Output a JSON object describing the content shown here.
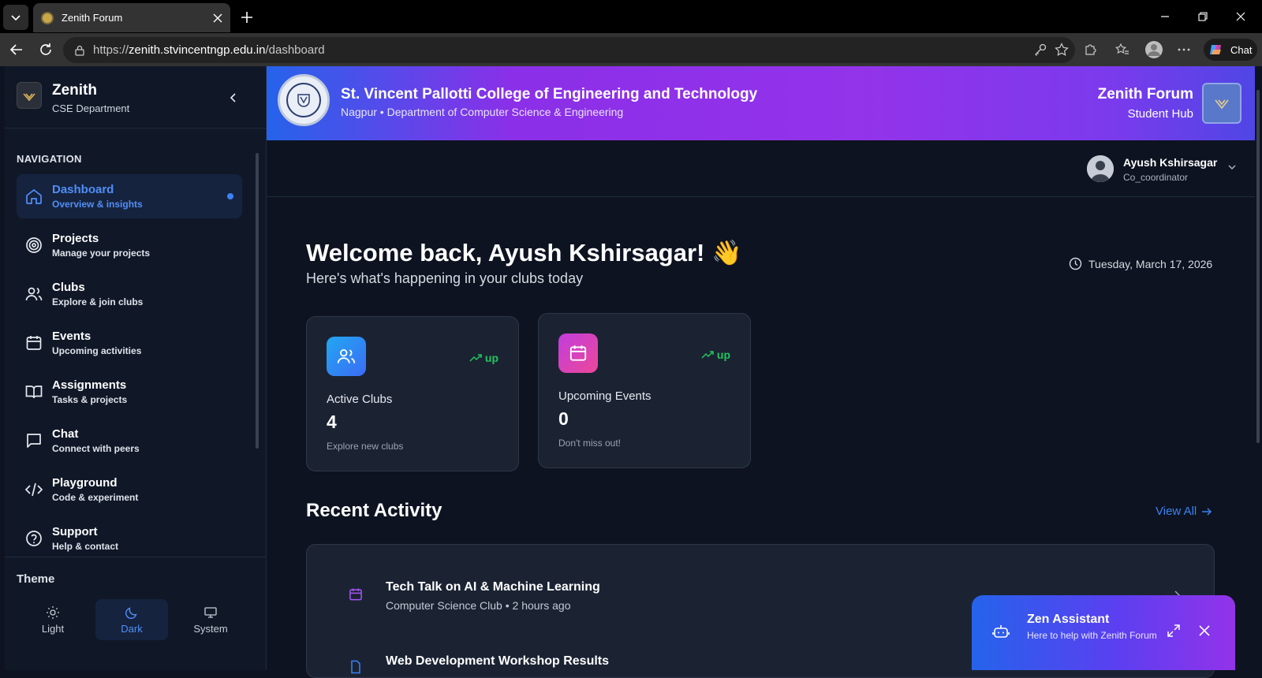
{
  "browser": {
    "tab_title": "Zenith Forum",
    "url_prefix": "https://",
    "url_host": "zenith.stvincentngp.edu.in",
    "url_path": "/dashboard",
    "chat_label": "Chat"
  },
  "sidebar": {
    "title": "Zenith",
    "subtitle": "CSE Department",
    "nav_heading": "NAVIGATION",
    "items": [
      {
        "label": "Dashboard",
        "desc": "Overview & insights",
        "icon": "home-icon",
        "active": true
      },
      {
        "label": "Projects",
        "desc": "Manage your projects",
        "icon": "target-icon"
      },
      {
        "label": "Clubs",
        "desc": "Explore & join clubs",
        "icon": "users-icon"
      },
      {
        "label": "Events",
        "desc": "Upcoming activities",
        "icon": "calendar-icon"
      },
      {
        "label": "Assignments",
        "desc": "Tasks & projects",
        "icon": "book-icon"
      },
      {
        "label": "Chat",
        "desc": "Connect with peers",
        "icon": "chat-icon"
      },
      {
        "label": "Playground",
        "desc": "Code & experiment",
        "icon": "code-icon"
      },
      {
        "label": "Support",
        "desc": "Help & contact",
        "icon": "help-icon"
      }
    ],
    "theme_heading": "Theme",
    "themes": [
      {
        "label": "Light",
        "icon": "sun-icon"
      },
      {
        "label": "Dark",
        "icon": "moon-icon",
        "active": true
      },
      {
        "label": "System",
        "icon": "monitor-icon"
      }
    ]
  },
  "banner": {
    "college": "St. Vincent Pallotti College of Engineering and Technology",
    "location": "Nagpur • Department of Computer Science & Engineering",
    "forum": "Zenith Forum",
    "hub": "Student Hub"
  },
  "user": {
    "name": "Ayush Kshirsagar",
    "role": "Co_coordinator"
  },
  "main": {
    "welcome": "Welcome back, Ayush Kshirsagar! 👋",
    "welcome_sub": "Here's what's happening in your clubs today",
    "date": "Tuesday, March 17, 2026"
  },
  "stats": [
    {
      "title": "Active Clubs",
      "value": "4",
      "sub": "Explore new clubs",
      "trend": "up",
      "icon": "users-icon"
    },
    {
      "title": "Upcoming Events",
      "value": "0",
      "sub": "Don't miss out!",
      "trend": "up",
      "icon": "calendar-icon"
    }
  ],
  "activity": {
    "title": "Recent Activity",
    "view_all": "View All",
    "items": [
      {
        "title": "Tech Talk on AI & Machine Learning",
        "club": "Computer Science Club",
        "time": "2 hours ago",
        "icon": "calendar-icon"
      },
      {
        "title": "Web Development Workshop Results",
        "icon": "file-icon"
      }
    ]
  },
  "assistant": {
    "title": "Zen Assistant",
    "subtitle": "Here to help with Zenith Forum"
  },
  "colors": {
    "accent": "#3b82f6",
    "trend_up": "#22c55e",
    "sidebar_bg": "#101828",
    "page_bg": "#0d1320",
    "card_bg": "#1b2333"
  }
}
